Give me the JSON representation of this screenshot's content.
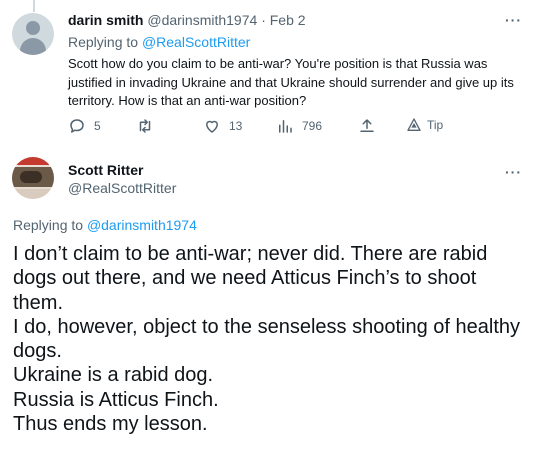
{
  "reply_tweet": {
    "display_name": "darin smith",
    "handle": "@darinsmith1974",
    "separator": "·",
    "date": "Feb 2",
    "replying_prefix": "Replying to",
    "replying_handle": "@RealScottRitter",
    "text": "Scott how do you claim to be anti-war? You're position is that Russia was justified in invading Ukraine and that Ukraine should surrender and give up its territory. How is that an anti-war position?",
    "actions": {
      "reply_count": "5",
      "retweet_count": "",
      "like_count": "13",
      "views_count": "796",
      "share_label": "",
      "tip_label": "Tip"
    },
    "more_glyph": "···"
  },
  "main_tweet": {
    "display_name": "Scott Ritter",
    "handle": "@RealScottRitter",
    "more_glyph": "···",
    "replying_prefix": "Replying to",
    "replying_handle": "@darinsmith1974",
    "lines": [
      "I don’t claim to be anti-war; never did. There are rabid dogs out there, and we need Atticus Finch’s to shoot them.",
      "I do, however, object to the senseless shooting of healthy dogs.",
      "Ukraine is a rabid dog.",
      "Russia is Atticus Finch.",
      "Thus ends my lesson."
    ]
  },
  "colors": {
    "accent": "#1d9bf0",
    "muted": "#536471",
    "text": "#0f1419"
  }
}
